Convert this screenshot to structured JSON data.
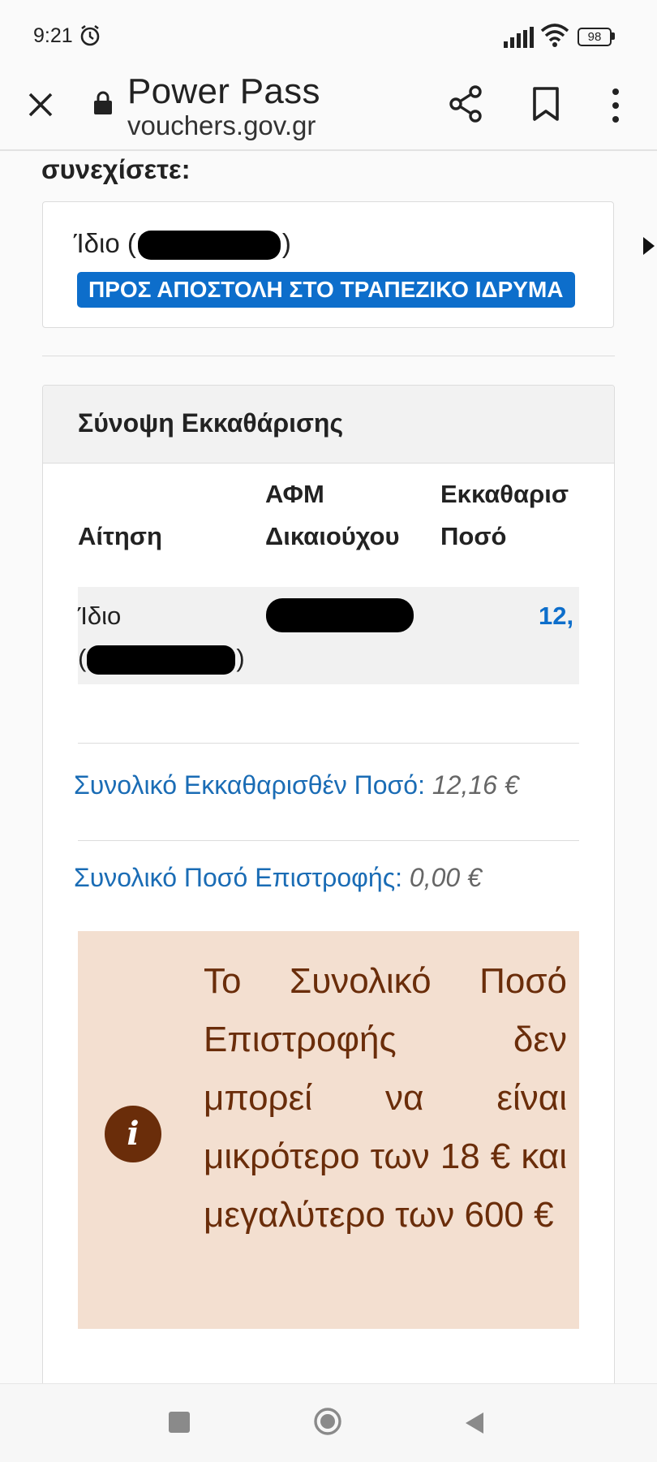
{
  "status_bar": {
    "time": "9:21",
    "battery": "98"
  },
  "browser": {
    "title": "Power Pass",
    "domain": "vouchers.gov.gr"
  },
  "page": {
    "section_heading": "συνεχίσετε:",
    "choice": {
      "label_prefix": "Ίδιο (",
      "label_suffix": ")",
      "badge": "ΠΡΟΣ ΑΠΟΣΤΟΛΗ ΣΤΟ ΤΡΑΠΕΖΙΚΟ ΙΔΡΥΜΑ"
    },
    "summary": {
      "title": "Σύνοψη Εκκαθάρισης",
      "columns": {
        "request": "Αίτηση",
        "afm_line1": "ΑΦΜ",
        "afm_line2": "Δικαιούχου",
        "amount_line1": "Εκκαθαρισ",
        "amount_line2": "Ποσό"
      },
      "row": {
        "request_line1": "Ίδιο",
        "request_open": "(",
        "request_close": ")",
        "amount": "12,"
      },
      "total_cleared_label": "Συνολικό Εκκαθαρισθέν Ποσό:",
      "total_cleared_value": "12,16 €",
      "total_refund_label": "Συνολικό Ποσό Επιστροφής:",
      "total_refund_value": "0,00 €",
      "alert_text": "Το Συνολικό Ποσό Επιστροφής δεν μπορεί να είναι μικρότερο των 18 € και μεγαλύτερο των 600 €",
      "alert_icon": "i"
    }
  },
  "colors": {
    "accent_blue": "#0d6ecb",
    "alert_bg": "#f3dfd0",
    "alert_text": "#6a2d0a"
  },
  "icons": [
    "alarm-icon",
    "signal-icon",
    "wifi-icon",
    "battery-icon",
    "close-icon",
    "lock-icon",
    "share-icon",
    "bookmark-icon",
    "overflow-menu-icon",
    "info-icon",
    "nav-recents-icon",
    "nav-home-icon",
    "nav-back-icon"
  ]
}
